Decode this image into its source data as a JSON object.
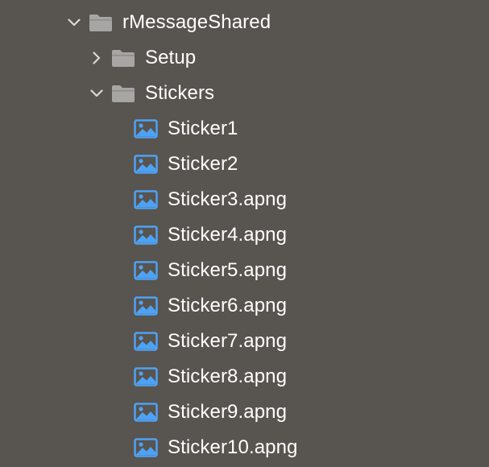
{
  "tree": {
    "root": {
      "label": "rMessageShared",
      "expanded": true,
      "icon": "folder-icon"
    },
    "folders": [
      {
        "label": "Setup",
        "expanded": false,
        "icon": "folder-icon"
      },
      {
        "label": "Stickers",
        "expanded": true,
        "icon": "folder-icon"
      }
    ],
    "files": [
      {
        "label": "Sticker1",
        "icon": "image-icon"
      },
      {
        "label": "Sticker2",
        "icon": "image-icon"
      },
      {
        "label": "Sticker3.apng",
        "icon": "image-icon"
      },
      {
        "label": "Sticker4.apng",
        "icon": "image-icon"
      },
      {
        "label": "Sticker5.apng",
        "icon": "image-icon"
      },
      {
        "label": "Sticker6.apng",
        "icon": "image-icon"
      },
      {
        "label": "Sticker7.apng",
        "icon": "image-icon"
      },
      {
        "label": "Sticker8.apng",
        "icon": "image-icon"
      },
      {
        "label": "Sticker9.apng",
        "icon": "image-icon"
      },
      {
        "label": "Sticker10.apng",
        "icon": "image-icon"
      }
    ]
  },
  "colors": {
    "background": "#58544f",
    "folder": "#a7a6a4",
    "image_icon": "#4ea2f5",
    "chevron": "#d9d8d6",
    "text": "#ffffff"
  }
}
